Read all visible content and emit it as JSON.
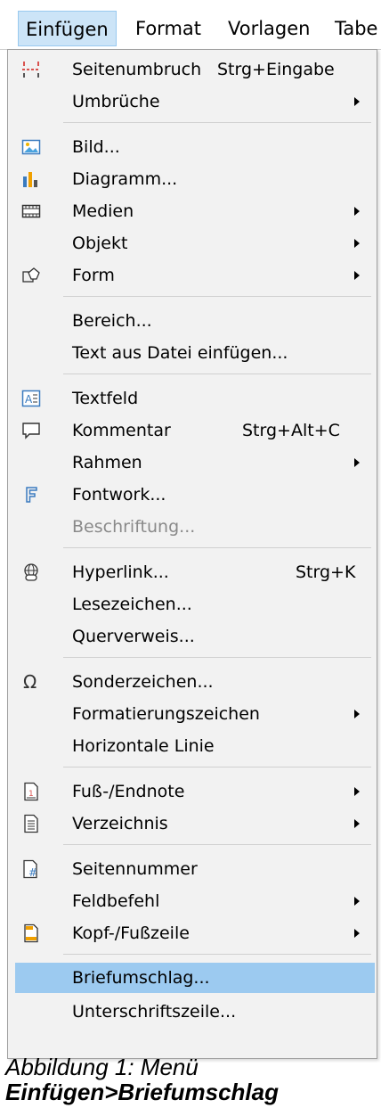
{
  "menubar": {
    "items": [
      {
        "label": "Einfügen"
      },
      {
        "label": "Format"
      },
      {
        "label": "Vorlagen"
      },
      {
        "label": "Tabe"
      }
    ]
  },
  "menu": {
    "items": [
      {
        "label": "Seitenumbruch",
        "shortcut": "Strg+Eingabe",
        "icon": "page-break-icon"
      },
      {
        "label": "Umbrüche",
        "submenu": true
      },
      {
        "label": "Bild...",
        "icon": "image-icon"
      },
      {
        "label": "Diagramm...",
        "icon": "chart-icon"
      },
      {
        "label": "Medien",
        "submenu": true,
        "icon": "media-icon"
      },
      {
        "label": "Objekt",
        "submenu": true
      },
      {
        "label": "Form",
        "submenu": true,
        "icon": "shape-icon"
      },
      {
        "label": "Bereich..."
      },
      {
        "label": "Text aus Datei einfügen..."
      },
      {
        "label": "Textfeld",
        "icon": "textbox-icon"
      },
      {
        "label": "Kommentar",
        "shortcut": "Strg+Alt+C",
        "icon": "comment-icon"
      },
      {
        "label": "Rahmen",
        "submenu": true
      },
      {
        "label": "Fontwork...",
        "icon": "fontwork-icon"
      },
      {
        "label": "Beschriftung...",
        "disabled": true
      },
      {
        "label": "Hyperlink...",
        "shortcut": "Strg+K",
        "icon": "hyperlink-icon"
      },
      {
        "label": "Lesezeichen..."
      },
      {
        "label": "Querverweis..."
      },
      {
        "label": "Sonderzeichen...",
        "icon": "omega-icon"
      },
      {
        "label": "Formatierungszeichen",
        "submenu": true
      },
      {
        "label": "Horizontale Linie"
      },
      {
        "label": "Fuß-/Endnote",
        "submenu": true,
        "icon": "footnote-icon"
      },
      {
        "label": "Verzeichnis",
        "submenu": true,
        "icon": "index-icon"
      },
      {
        "label": "Seitennummer",
        "icon": "page-number-icon"
      },
      {
        "label": "Feldbefehl",
        "submenu": true
      },
      {
        "label": "Kopf-/Fußzeile",
        "submenu": true,
        "icon": "header-footer-icon"
      },
      {
        "label": "Briefumschlag...",
        "highlighted": true
      },
      {
        "label": "Unterschriftszeile..."
      }
    ]
  },
  "caption": {
    "line1": "Abbildung 1: Menü",
    "line2": "Einfügen>Briefumschlag"
  },
  "colors": {
    "highlight": "#9ccaf0",
    "menubar_active": "#cce4f7",
    "menu_background": "#f2f2f2"
  }
}
